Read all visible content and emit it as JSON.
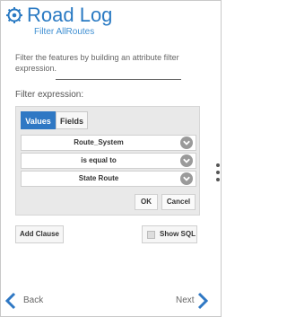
{
  "header": {
    "title": "Road Log",
    "subtitle": "Filter AllRoutes",
    "icon": "gear-icon"
  },
  "description": "Filter the features by building an attribute filter expression.",
  "filter": {
    "label": "Filter expression:",
    "tabs": [
      {
        "label": "Values",
        "active": true
      },
      {
        "label": "Fields",
        "active": false
      }
    ],
    "field_value": "Route_System",
    "operator_value": "is equal to",
    "value_value": "State Route",
    "ok_label": "OK",
    "cancel_label": "Cancel"
  },
  "actions": {
    "add_clause_label": "Add Clause",
    "show_sql_label": "Show SQL",
    "show_sql_checked": false
  },
  "nav": {
    "back_label": "Back",
    "next_label": "Next"
  },
  "colors": {
    "accent": "#2f78c4",
    "title": "#2a7ac3",
    "chevron_bg": "#9a9a9a"
  }
}
